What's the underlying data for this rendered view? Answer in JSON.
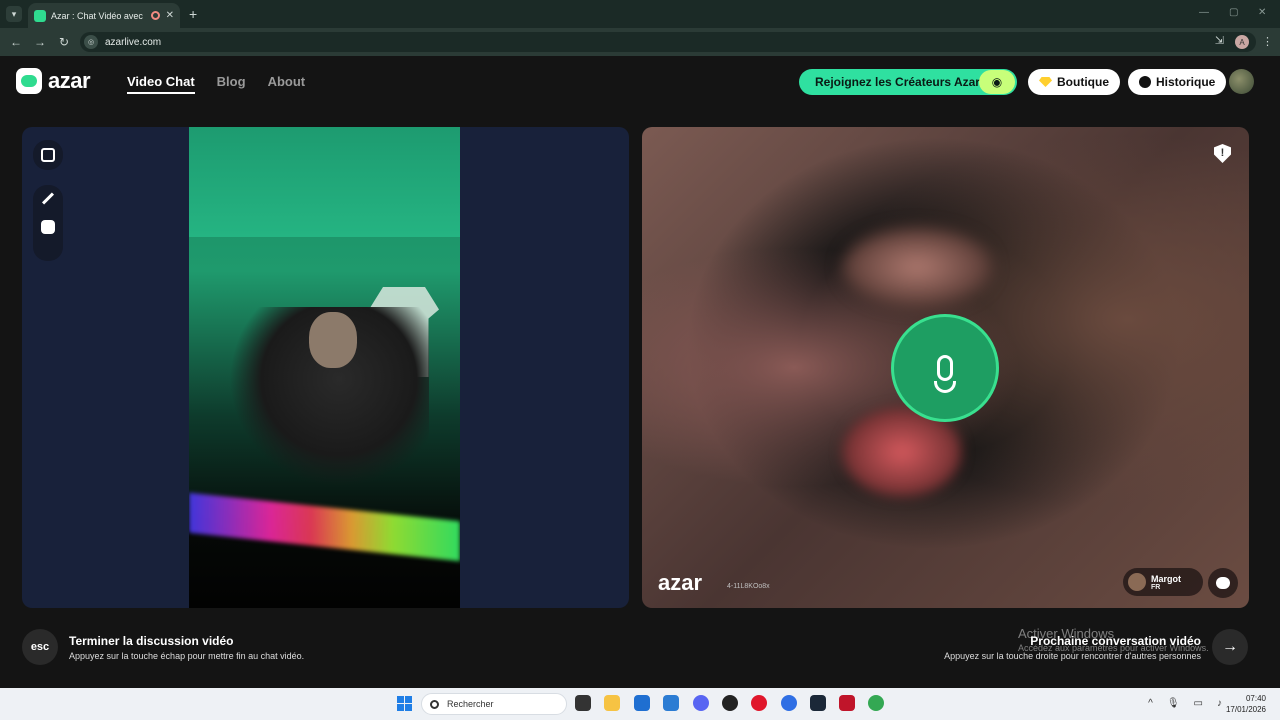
{
  "browser": {
    "tab_title": "Azar : Chat Vidéo avec de n",
    "url": "azarlive.com",
    "profile_initial": "A",
    "close_glyph": "✕",
    "new_tab_glyph": "+"
  },
  "header": {
    "logo_text": "azar",
    "nav": {
      "video_chat": "Video Chat",
      "blog": "Blog",
      "about": "About"
    },
    "creators_label": "Rejoignez les Créateurs Azar",
    "boutique_label": "Boutique",
    "historique_label": "Historique"
  },
  "remote": {
    "watermark": "azar",
    "watermark_id": "4-11L8KOo8x",
    "user_name": "Margot",
    "user_country": "FR"
  },
  "controls": {
    "esc_label": "esc",
    "end_title": "Terminer la discussion vidéo",
    "end_sub": "Appuyez sur la touche échap pour mettre fin au chat vidéo.",
    "next_title": "Prochaine conversation vidéo",
    "next_sub": "Appuyez sur la touche droite pour rencontrer d'autres personnes",
    "activate_title": "Activer Windows",
    "activate_sub": "Accédez aux paramètres pour activer Windows."
  },
  "taskbar": {
    "search_placeholder": "Rechercher",
    "time": "07:40",
    "date": "17/01/2026"
  },
  "colors": {
    "accent": "#2fe0a0",
    "mic": "#1e9e62",
    "panel_bg": "#18213a"
  }
}
